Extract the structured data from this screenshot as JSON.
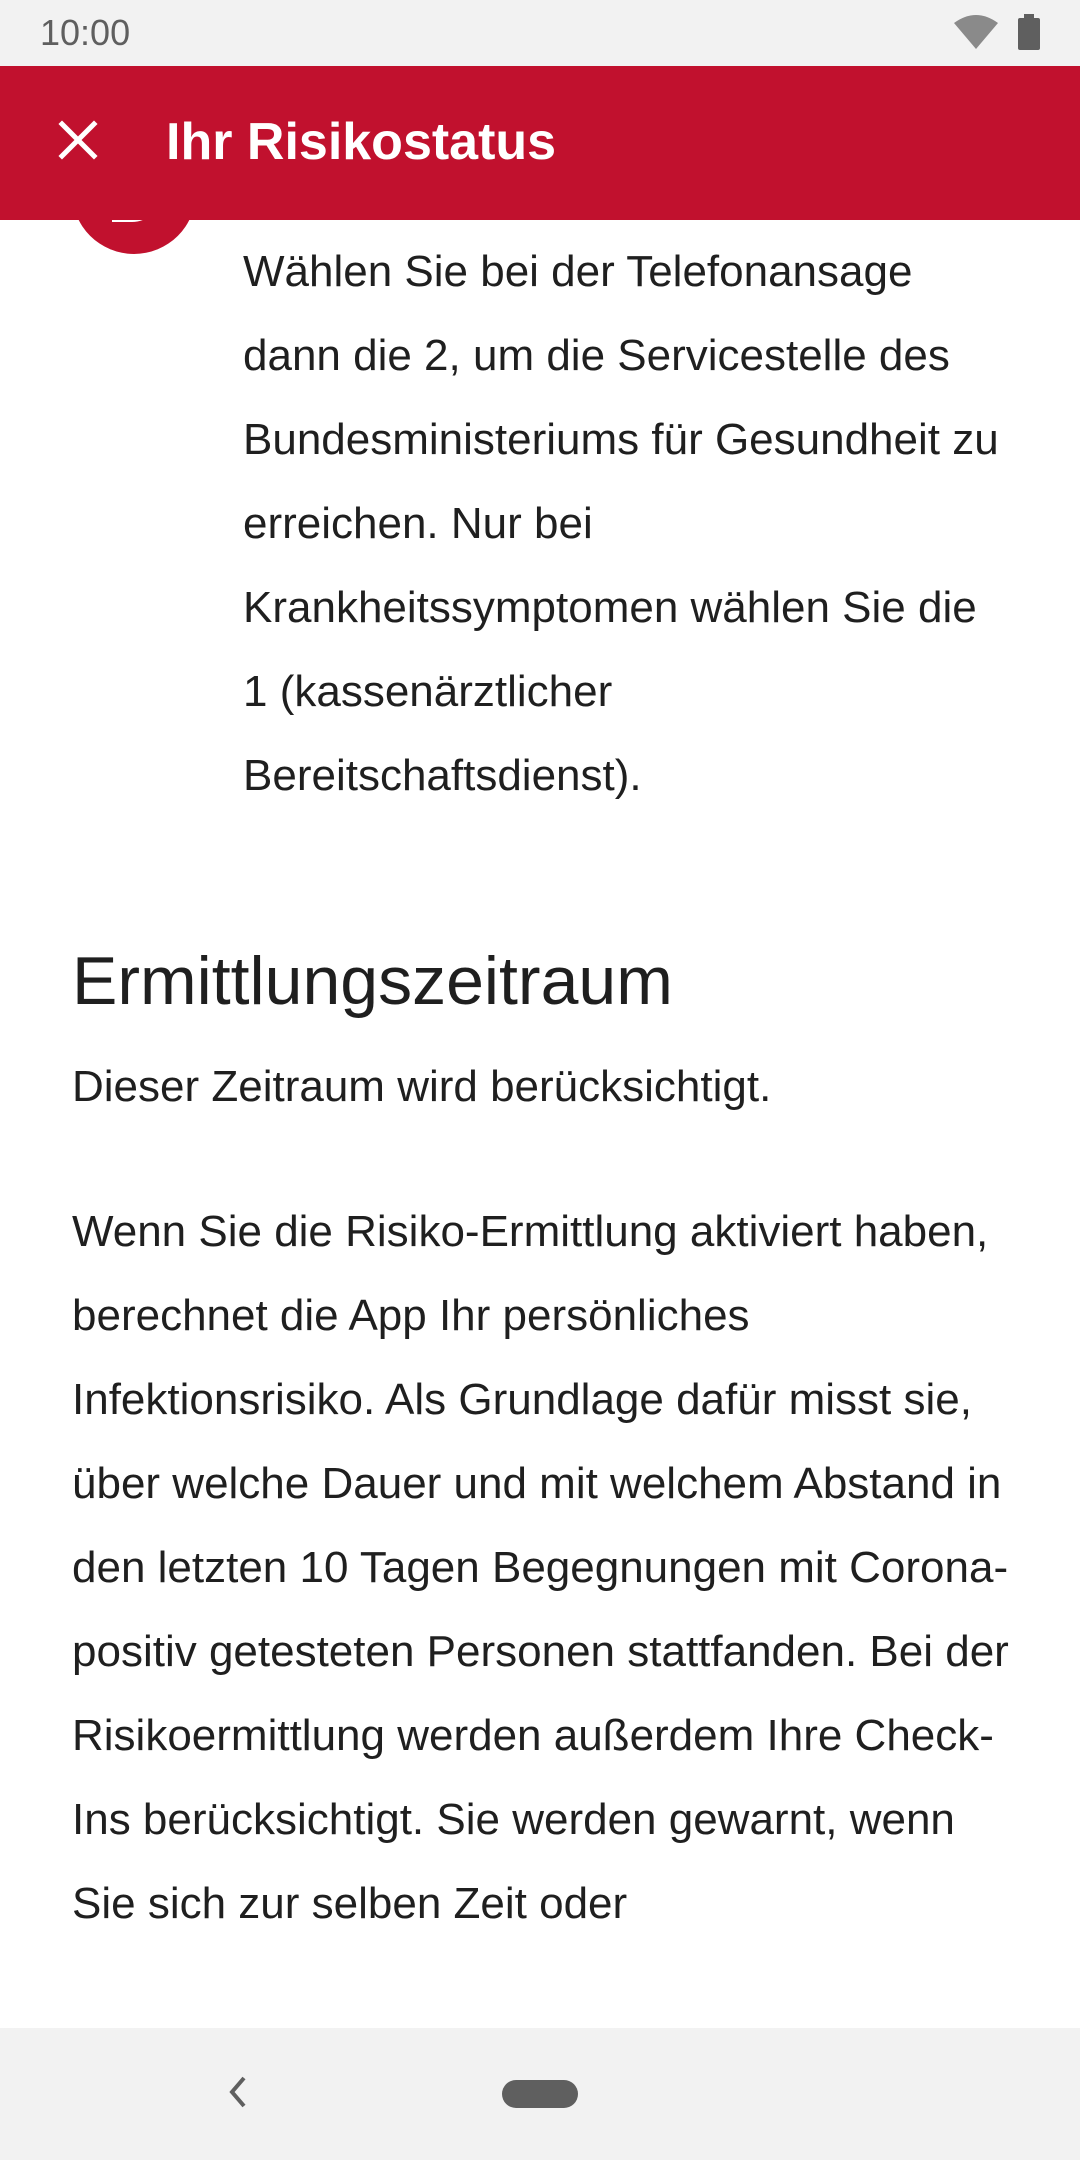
{
  "status_bar": {
    "time": "10:00",
    "icons": [
      "wifi-icon",
      "battery-icon"
    ]
  },
  "app_bar": {
    "title": "Ihr Risikostatus",
    "close_icon": "close-icon",
    "background_color": "#c1112e"
  },
  "hotline": {
    "icon": "phone-icon",
    "text": "Wählen Sie bei der Telefonansage dann die 2, um die Servicestelle des Bundesministeriums für Gesundheit zu erreichen. Nur bei Krankheitssymptomen wählen Sie die 1 (kassenärztlicher Bereitschaftsdienst)."
  },
  "period_section": {
    "title": "Ermittlungszeitraum",
    "subtitle": "Dieser Zeitraum wird berücksichtigt.",
    "body": "Wenn Sie die Risiko-Ermittlung aktiviert haben, berechnet die App Ihr persönliches Infektionsrisiko. Als Grundlage dafür misst sie, über welche Dauer und mit welchem Abstand in den letzten 10 Tagen Begegnungen mit Corona-positiv getesteten Personen stattfanden. Bei der Risikoermittlung werden außerdem Ihre Check-Ins berücksichtigt. Sie werden gewarnt, wenn Sie sich zur selben Zeit oder"
  },
  "nav_bar": {
    "back_icon": "back-chevron-icon",
    "home_icon": "home-pill-icon"
  }
}
